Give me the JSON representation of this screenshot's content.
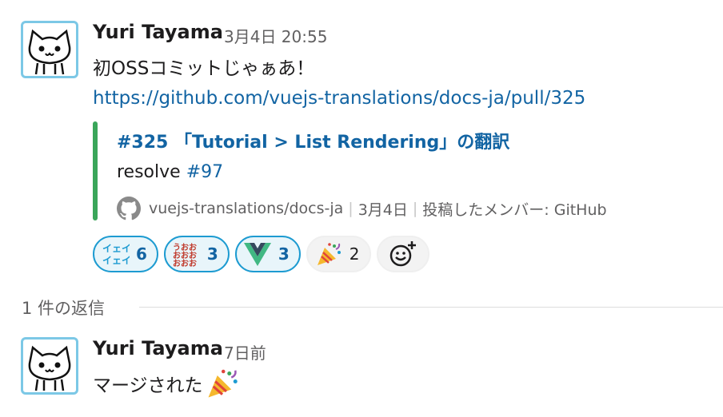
{
  "message1": {
    "author": "Yuri Tayama",
    "timestamp": "3月4日 20:55",
    "text": "初OSSコミットじゃぁあ！",
    "link": "https://github.com/vuejs-translations/docs-ja/pull/325",
    "attachment": {
      "title": "#325 「Tutorial > List Rendering」の翻訳",
      "body_text": "resolve ",
      "body_ref": "#97",
      "footer": {
        "repo": "vuejs-translations/docs-ja",
        "date": "3月4日",
        "posted_by": "投稿したメンバー: GitHub"
      },
      "accent_color": "#3aa65a"
    },
    "reactions": [
      {
        "emoji": "iei-custom-icon",
        "count": "6",
        "active": true
      },
      {
        "emoji": "uooo-custom-icon",
        "count": "3",
        "active": true
      },
      {
        "emoji": "vue-logo-icon",
        "count": "3",
        "active": true
      },
      {
        "emoji": "party-popper-icon",
        "count": "2",
        "active": false
      }
    ]
  },
  "thread": {
    "label": "1 件の返信"
  },
  "message2": {
    "author": "Yuri Tayama",
    "timestamp": "7日前",
    "text": "マージされた"
  },
  "colors": {
    "link": "#1264a3",
    "reaction_active_border": "#1d9bd1",
    "reaction_active_bg": "#e8f5fa",
    "avatar_border": "#7cc8e6"
  }
}
